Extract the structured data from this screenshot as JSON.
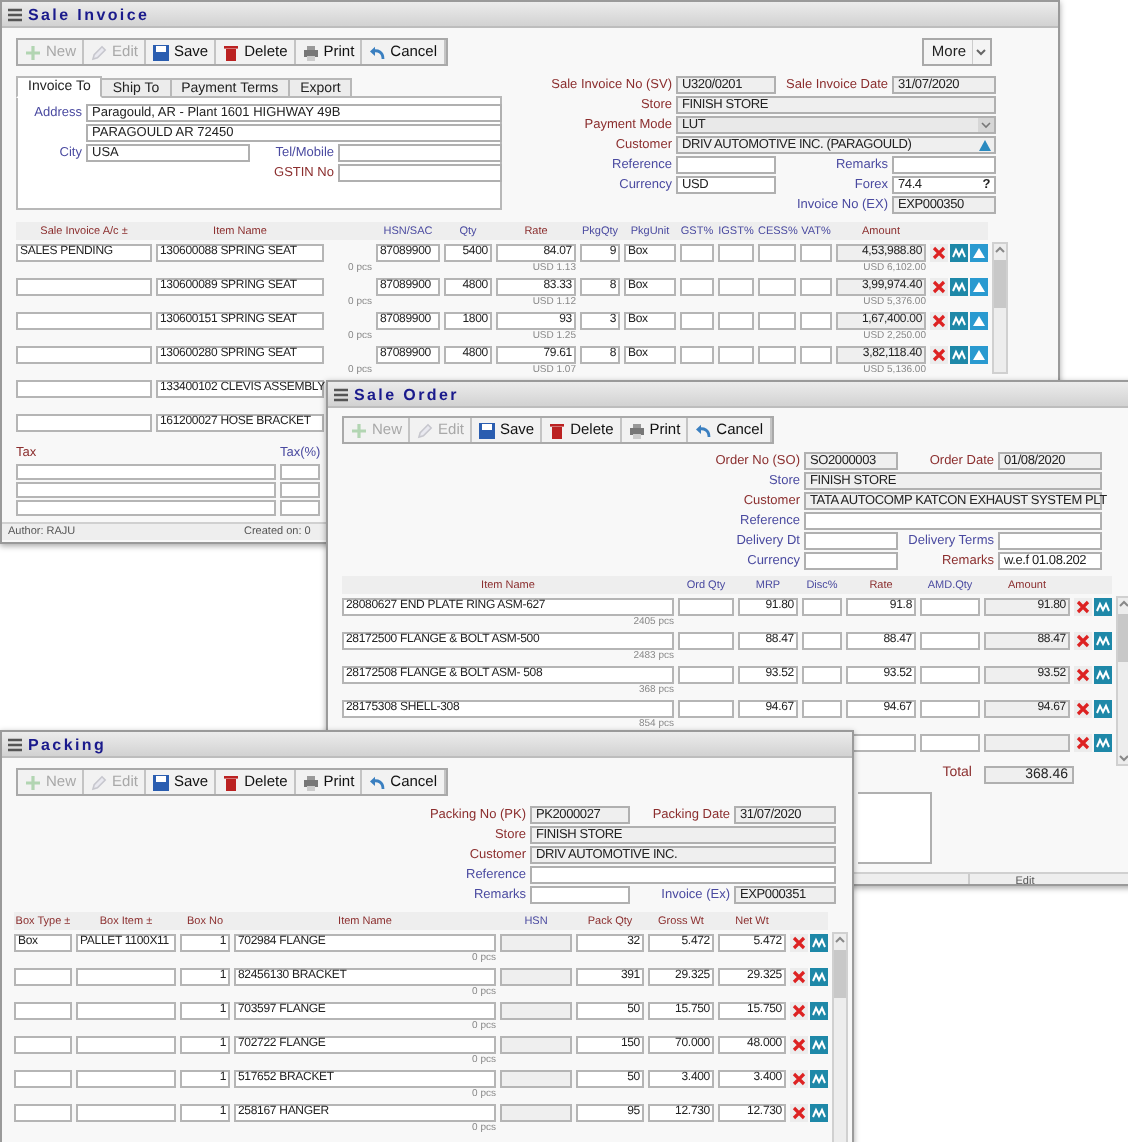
{
  "sale_invoice": {
    "title": "Sale Invoice",
    "toolbar": [
      {
        "kind": "new",
        "label": "New",
        "disabled": true
      },
      {
        "kind": "edit",
        "label": "Edit",
        "disabled": true
      },
      {
        "kind": "save",
        "label": "Save",
        "disabled": false
      },
      {
        "kind": "delete",
        "label": "Delete",
        "disabled": false
      },
      {
        "kind": "print",
        "label": "Print",
        "disabled": false
      },
      {
        "kind": "cancel",
        "label": "Cancel",
        "disabled": false
      }
    ],
    "more_button": "More",
    "tabs": [
      {
        "label": "Invoice To",
        "selected": true
      },
      {
        "label": "Ship To",
        "selected": false
      },
      {
        "label": "Payment Terms",
        "selected": false
      },
      {
        "label": "Export",
        "selected": false
      }
    ],
    "invoice_to": {
      "address_label": "Address",
      "address_lines": [
        "Paragould, AR - Plant 1601 HIGHWAY 49B",
        "PARAGOULD AR 72450"
      ],
      "city_label": "City",
      "city": "USA",
      "tel_label": "Tel/Mobile",
      "gstin_label": "GSTIN No"
    },
    "fields": [
      {
        "left": {
          "label": "Sale Invoice No (SV)",
          "required": true,
          "kind": "readonly",
          "value": "U320/0201"
        },
        "right": {
          "label": "Sale Invoice Date",
          "required": true,
          "kind": "readonly",
          "value": "31/07/2020"
        }
      },
      {
        "wide": {
          "label": "Store",
          "required": true,
          "kind": "readonly",
          "value": "FINISH STORE"
        }
      },
      {
        "wide": {
          "label": "Payment Mode",
          "required": true,
          "kind": "select",
          "value": "LUT"
        }
      },
      {
        "wide": {
          "label": "Customer",
          "required": true,
          "kind": "lookup",
          "value": "DRIV AUTOMOTIVE INC. (PARAGOULD)"
        }
      },
      {
        "left": {
          "label": "Reference",
          "required": false,
          "kind": "input"
        },
        "right": {
          "label": "Remarks",
          "required": false,
          "kind": "input"
        }
      },
      {
        "left": {
          "label": "Currency",
          "required": false,
          "kind": "input",
          "value": "USD"
        },
        "right": {
          "label": "Forex",
          "required": false,
          "kind": "help",
          "value": "74.4",
          "button": "?"
        }
      },
      {
        "right": {
          "label": "Invoice No (EX)",
          "required": false,
          "kind": "readonly",
          "value": "EXP000350"
        }
      }
    ],
    "table": {
      "columns": [
        {
          "label": "Sale Invoice A/c ±",
          "required": true
        },
        {
          "label": "Item Name",
          "required": true
        },
        {
          "label": "HSN/SAC",
          "required": false
        },
        {
          "label": "Qty",
          "required": false
        },
        {
          "label": "Rate",
          "required": true
        },
        {
          "label": "PkgQty",
          "required": false
        },
        {
          "label": "PkgUnit",
          "required": false
        },
        {
          "label": "GST%",
          "required": false
        },
        {
          "label": "IGST%",
          "required": false
        },
        {
          "label": "CESS%",
          "required": false
        },
        {
          "label": "VAT%",
          "required": false
        },
        {
          "label": "Amount",
          "required": true
        }
      ],
      "rows": [
        {
          "account": "SALES PENDING",
          "item": "130600088 SPRING SEAT",
          "hsn": "87089900",
          "qty": "5400",
          "rate": "84.07",
          "pkg_qty": "9",
          "pkg_unit": "Box",
          "amount": "4,53,988.80",
          "item_note": "0 pcs",
          "rate_note": "USD 1.13",
          "amount_note": "USD 6,102.00"
        },
        {
          "item": "130600089 SPRING SEAT",
          "hsn": "87089900",
          "qty": "4800",
          "rate": "83.33",
          "pkg_qty": "8",
          "pkg_unit": "Box",
          "amount": "3,99,974.40",
          "item_note": "0 pcs",
          "rate_note": "USD 1.12",
          "amount_note": "USD 5,376.00"
        },
        {
          "item": "130600151 SPRING SEAT",
          "hsn": "87089900",
          "qty": "1800",
          "rate": "93",
          "pkg_qty": "3",
          "pkg_unit": "Box",
          "amount": "1,67,400.00",
          "item_note": "0 pcs",
          "rate_note": "USD 1.25",
          "amount_note": "USD 2,250.00"
        },
        {
          "item": "130600280 SPRING SEAT",
          "hsn": "87089900",
          "qty": "4800",
          "rate": "79.61",
          "pkg_qty": "8",
          "pkg_unit": "Box",
          "amount": "3,82,118.40",
          "item_note": "0 pcs",
          "rate_note": "USD 1.07",
          "amount_note": "USD 5,136.00"
        },
        {
          "item": "133400102 CLEVIS ASSEMBLY"
        },
        {
          "item": "161200027 HOSE BRACKET"
        }
      ]
    },
    "tax_columns": [
      "Tax",
      "Tax(%)"
    ],
    "footer": {
      "author": "Author: RAJU",
      "created": "Created on: 0"
    }
  },
  "sale_order": {
    "title": "Sale Order",
    "toolbar": [
      {
        "kind": "new",
        "label": "New",
        "disabled": true
      },
      {
        "kind": "edit",
        "label": "Edit",
        "disabled": true
      },
      {
        "kind": "save",
        "label": "Save",
        "disabled": false
      },
      {
        "kind": "delete",
        "label": "Delete",
        "disabled": false
      },
      {
        "kind": "print",
        "label": "Print",
        "disabled": false
      },
      {
        "kind": "cancel",
        "label": "Cancel",
        "disabled": false
      }
    ],
    "fields": [
      {
        "left": {
          "label": "Order No (SO)",
          "required": true,
          "kind": "readonly",
          "value": "SO2000003"
        },
        "right": {
          "label": "Order Date",
          "required": true,
          "kind": "readonly",
          "value": "01/08/2020"
        }
      },
      {
        "wide": {
          "label": "Store",
          "required": false,
          "kind": "readonly",
          "value": "FINISH STORE"
        }
      },
      {
        "wide": {
          "label": "Customer",
          "required": true,
          "kind": "readonly",
          "value": "TATA AUTOCOMP KATCON EXHAUST SYSTEM PLT"
        }
      },
      {
        "wide": {
          "label": "Reference",
          "required": false,
          "kind": "input"
        }
      },
      {
        "left": {
          "label": "Delivery Dt",
          "required": false,
          "kind": "input"
        },
        "right": {
          "label": "Delivery Terms",
          "required": false,
          "kind": "input"
        }
      },
      {
        "left": {
          "label": "Currency",
          "required": false,
          "kind": "input"
        },
        "right": {
          "label": "Remarks",
          "required": true,
          "kind": "input",
          "value": "w.e.f 01.08.202"
        }
      }
    ],
    "table": {
      "columns": [
        {
          "label": "Item Name",
          "required": true
        },
        {
          "label": "Ord Qty",
          "required": false
        },
        {
          "label": "MRP",
          "required": false
        },
        {
          "label": "Disc%",
          "required": false
        },
        {
          "label": "Rate",
          "required": true
        },
        {
          "label": "AMD.Qty",
          "required": false
        },
        {
          "label": "Amount",
          "required": true
        }
      ],
      "rows": [
        {
          "item": "28080627 END PLATE RING ASM-627",
          "mrp": "91.80",
          "rate": "91.8",
          "amount": "91.80",
          "item_note": "2405 pcs"
        },
        {
          "item": "28172500 FLANGE & BOLT ASM-500",
          "mrp": "88.47",
          "rate": "88.47",
          "amount": "88.47",
          "item_note": "2483 pcs"
        },
        {
          "item": "28172508 FLANGE & BOLT ASM- 508",
          "mrp": "93.52",
          "rate": "93.52",
          "amount": "93.52",
          "item_note": "368 pcs"
        },
        {
          "item": "28175308 SHELL-308",
          "mrp": "94.67",
          "rate": "94.67",
          "amount": "94.67",
          "item_note": "854 pcs"
        },
        {}
      ]
    },
    "total_label": "Total",
    "total": "368.46",
    "footer": "Edit"
  },
  "packing": {
    "title": "Packing",
    "toolbar": [
      {
        "kind": "new",
        "label": "New",
        "disabled": true
      },
      {
        "kind": "edit",
        "label": "Edit",
        "disabled": true
      },
      {
        "kind": "save",
        "label": "Save",
        "disabled": false
      },
      {
        "kind": "delete",
        "label": "Delete",
        "disabled": false
      },
      {
        "kind": "print",
        "label": "Print",
        "disabled": false
      },
      {
        "kind": "cancel",
        "label": "Cancel",
        "disabled": false
      }
    ],
    "fields": [
      {
        "left": {
          "label": "Packing No (PK)",
          "required": true,
          "kind": "readonly",
          "value": "PK2000027"
        },
        "right": {
          "label": "Packing Date",
          "required": true,
          "kind": "readonly",
          "value": "31/07/2020"
        }
      },
      {
        "wide": {
          "label": "Store",
          "required": true,
          "kind": "readonly",
          "value": "FINISH STORE"
        }
      },
      {
        "wide": {
          "label": "Customer",
          "required": true,
          "kind": "readonly",
          "value": "DRIV AUTOMOTIVE INC."
        }
      },
      {
        "wide": {
          "label": "Reference",
          "required": false,
          "kind": "input"
        }
      },
      {
        "left": {
          "label": "Remarks",
          "required": false,
          "kind": "input"
        },
        "right": {
          "label": "Invoice (Ex)",
          "required": false,
          "kind": "readonly",
          "value": "EXP000351"
        }
      }
    ],
    "table": {
      "columns": [
        {
          "label": "Box Type ±",
          "required": true
        },
        {
          "label": "Box Item ±",
          "required": true
        },
        {
          "label": "Box No",
          "required": true
        },
        {
          "label": "Item Name",
          "required": true
        },
        {
          "label": "HSN",
          "required": false
        },
        {
          "label": "Pack Qty",
          "required": true
        },
        {
          "label": "Gross Wt",
          "required": true
        },
        {
          "label": "Net Wt",
          "required": true
        }
      ],
      "rows": [
        {
          "box_type": "Box",
          "box_item": "PALLET 1100X11",
          "box_no": "1",
          "item": "702984 FLANGE",
          "pack_qty": "32",
          "gross_wt": "5.472",
          "net_wt": "5.472",
          "item_note": "0 pcs"
        },
        {
          "box_no": "1",
          "item": "82456130 BRACKET",
          "pack_qty": "391",
          "gross_wt": "29.325",
          "net_wt": "29.325",
          "item_note": "0 pcs"
        },
        {
          "box_no": "1",
          "item": "703597 FLANGE",
          "pack_qty": "50",
          "gross_wt": "15.750",
          "net_wt": "15.750",
          "item_note": "0 pcs"
        },
        {
          "box_no": "1",
          "item": "702722 FLANGE",
          "pack_qty": "150",
          "gross_wt": "70.000",
          "net_wt": "48.000",
          "item_note": "0 pcs"
        },
        {
          "box_no": "1",
          "item": "517652 BRACKET",
          "pack_qty": "50",
          "gross_wt": "3.400",
          "net_wt": "3.400",
          "item_note": "0 pcs"
        },
        {
          "box_no": "1",
          "item": "258167 HANGER",
          "pack_qty": "95",
          "gross_wt": "12.730",
          "net_wt": "12.730",
          "item_note": "0 pcs"
        }
      ]
    }
  }
}
